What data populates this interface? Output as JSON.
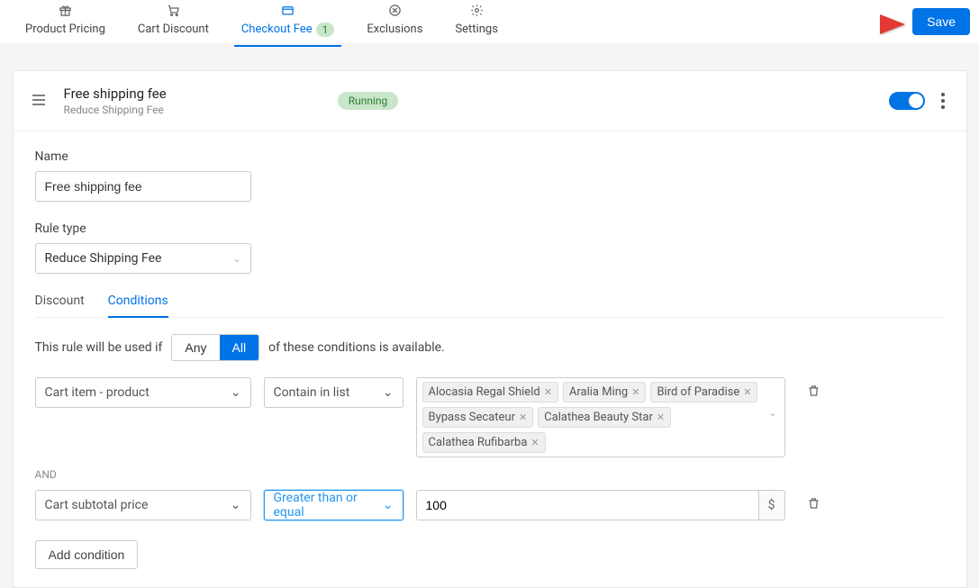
{
  "topTabs": [
    {
      "label": "Product Pricing",
      "active": false
    },
    {
      "label": "Cart Discount",
      "active": false
    },
    {
      "label": "Checkout Fee",
      "active": true,
      "badge": "1"
    },
    {
      "label": "Exclusions",
      "active": false
    },
    {
      "label": "Settings",
      "active": false
    }
  ],
  "saveLabel": "Save",
  "rule": {
    "title": "Free shipping fee",
    "subtitle": "Reduce Shipping Fee",
    "status": "Running"
  },
  "form": {
    "nameLabel": "Name",
    "nameValue": "Free shipping fee",
    "ruleTypeLabel": "Rule type",
    "ruleTypeValue": "Reduce Shipping Fee"
  },
  "innerTabs": {
    "discount": "Discount",
    "conditions": "Conditions"
  },
  "condIntro": {
    "prefix": "This rule will be used if",
    "any": "Any",
    "all": "All",
    "suffix": "of these conditions is available."
  },
  "condition1": {
    "field": "Cart item - product",
    "operator": "Contain in list",
    "tags": [
      "Alocasia Regal Shield",
      "Aralia Ming",
      "Bird of Paradise",
      "Bypass Secateur",
      "Calathea Beauty Star",
      "Calathea Rufibarba"
    ]
  },
  "andLabel": "AND",
  "condition2": {
    "field": "Cart subtotal price",
    "operator": "Greater than or equal",
    "value": "100",
    "suffix": "$"
  },
  "addCondition": "Add condition"
}
